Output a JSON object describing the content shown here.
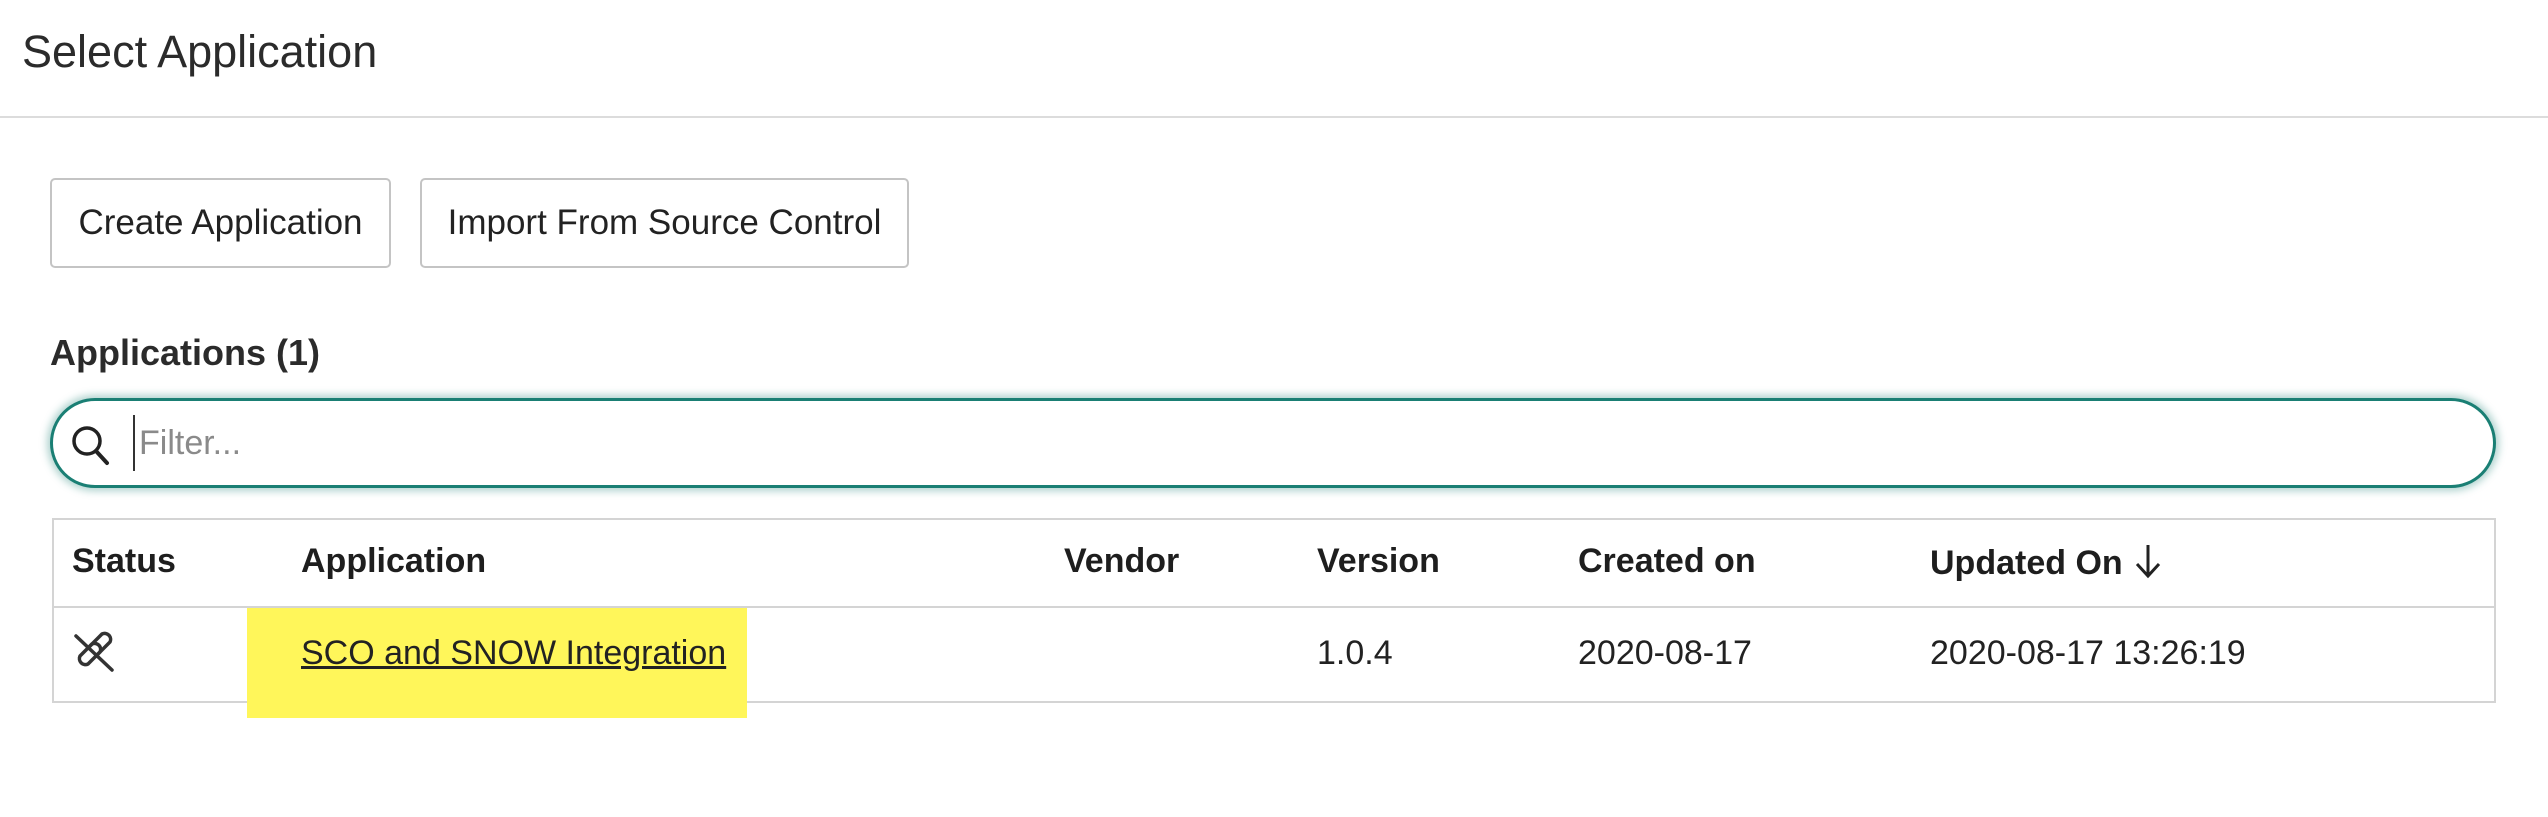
{
  "header": {
    "title": "Select Application"
  },
  "toolbar": {
    "create_label": "Create Application",
    "import_label": "Import From Source Control"
  },
  "applications": {
    "title": "Applications (1)",
    "filter": {
      "placeholder": "Filter...",
      "value": ""
    },
    "columns": {
      "status": "Status",
      "application": "Application",
      "vendor": "Vendor",
      "version": "Version",
      "created": "Created on",
      "updated": "Updated On"
    },
    "sort": {
      "column": "Updated On",
      "direction": "descending",
      "icon": "arrow-down-icon"
    },
    "rows": [
      {
        "status_icon": "unlinked-icon",
        "application": "SCO and SNOW Integration",
        "vendor": "",
        "version": "1.0.4",
        "created": "2020-08-17",
        "updated": "2020-08-17 13:26:19",
        "highlight_color": "#fff65a"
      }
    ]
  },
  "colors": {
    "accent": "#1a7f74",
    "highlight": "#fff65a",
    "border": "#d4d4d4"
  }
}
